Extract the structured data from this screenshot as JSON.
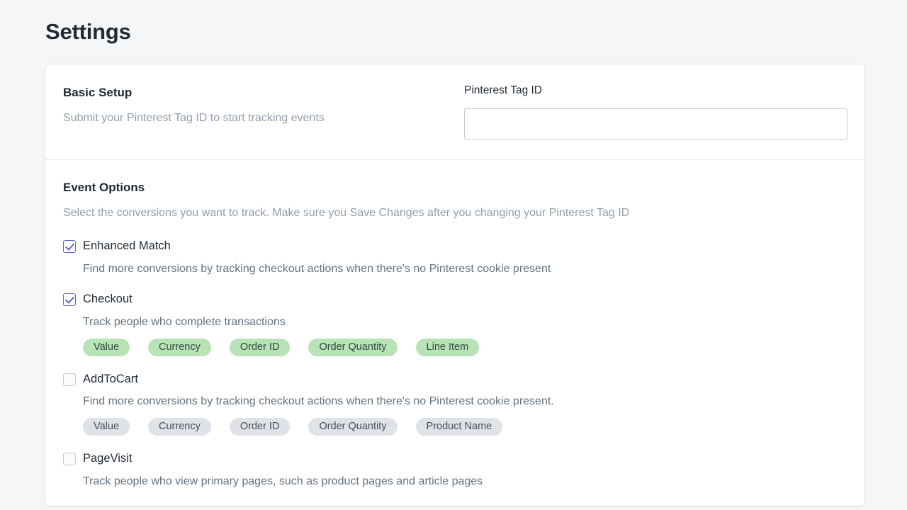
{
  "page": {
    "title": "Settings"
  },
  "basic_setup": {
    "heading": "Basic Setup",
    "subtext": "Submit your Pinterest Tag ID to start tracking events",
    "field_label": "Pinterest Tag ID",
    "field_value": "",
    "field_placeholder": ""
  },
  "event_options": {
    "heading": "Event Options",
    "subtext": "Select the conversions you want to track. Make sure you Save Changes after you changing your Pinterest Tag ID",
    "events": [
      {
        "name": "Enhanced Match",
        "checked": true,
        "checkbox_state": "checked",
        "description": "Find more conversions by tracking checkout actions when there's no Pinterest cookie present",
        "pills": [],
        "pill_style": "green"
      },
      {
        "name": "Checkout",
        "checked": true,
        "checkbox_state": "checked",
        "description": "Track people who complete transactions",
        "pills": [
          "Value",
          "Currency",
          "Order ID",
          "Order Quantity",
          "Line Item"
        ],
        "pill_style": "green"
      },
      {
        "name": "AddToCart",
        "checked": false,
        "checkbox_state": "unchecked",
        "description": "Find more conversions by tracking checkout actions when there's no Pinterest cookie present.",
        "pills": [
          "Value",
          "Currency",
          "Order ID",
          "Order Quantity",
          "Product Name"
        ],
        "pill_style": "grey"
      },
      {
        "name": "PageVisit",
        "checked": false,
        "checkbox_state": "unchecked",
        "description": "Track people who view primary pages, such as product pages and article pages",
        "pills": [],
        "pill_style": "grey"
      }
    ]
  },
  "colors": {
    "page_background": "#f4f6f8",
    "card_background": "#ffffff",
    "heading_text": "#212b36",
    "muted_text": "#919eab",
    "body_text": "#637381",
    "checkbox_accent": "#5c6ac4",
    "pill_green_bg": "#b7e3b6",
    "pill_grey_bg": "#dfe3e8",
    "input_border": "#c4cdd5",
    "divider": "#e6e8eb"
  }
}
